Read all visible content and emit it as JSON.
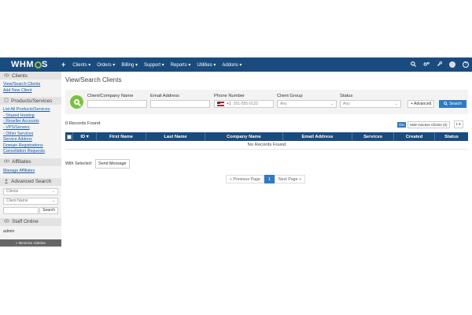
{
  "app": {
    "logo_text": "WHMCS"
  },
  "topnav": {
    "add_icon": "plus-icon",
    "items": [
      "Clients ▾",
      "Orders ▾",
      "Billing ▾",
      "Support ▾",
      "Reports ▾",
      "Utilities ▾",
      "Addons ▾"
    ],
    "right_icons": [
      "search-icon",
      "gears-icon",
      "wrench-icon",
      "user-icon",
      "help-icon"
    ]
  },
  "sidebar": {
    "clients": {
      "title": "Clients",
      "links": [
        "View/Search Clients",
        "Add New Client"
      ]
    },
    "products": {
      "title": "Products/Services",
      "links": [
        "List All Products/Services",
        "- Shared Hosting",
        "- Reseller Accounts",
        "- VPS/Servers",
        "- Other Services",
        "Service Addons",
        "Domain Registrations",
        "Cancellation Requests"
      ]
    },
    "affiliates": {
      "title": "Affiliates",
      "links": [
        "Manage Affiliates"
      ]
    },
    "advanced_search": {
      "title": "Advanced Search",
      "type_value": "Clients",
      "field_value": "Client Name",
      "search_button": "Search"
    },
    "staff_online": {
      "title": "Staff Online",
      "user": "admin"
    },
    "minimize": "« Minimise Sidebar"
  },
  "main": {
    "title": "View/Search Clients",
    "filters": {
      "name_label": "Client/Company Name",
      "email_label": "Email Address",
      "phone_label": "Phone Number",
      "phone_code": "+1",
      "phone_placeholder": "201-555-0123",
      "group_label": "Client Group",
      "group_value": "Any",
      "status_label": "Status",
      "status_value": "Any",
      "advanced_button": "+ Advanced",
      "search_button": "Search"
    },
    "records_text": "0 Records Found",
    "toggle": {
      "badge": "ON",
      "label": "Hide Inactive Clients (0)"
    },
    "per_page": "1 ▾",
    "table": {
      "columns": [
        "ID ▾",
        "First Name",
        "Last Name",
        "Company Name",
        "Email Address",
        "Services",
        "Created",
        "Status"
      ],
      "empty_text": "No Records Found"
    },
    "with_selected_label": "With Selected:",
    "send_message_button": "Send Message",
    "pager": {
      "prev": "« Previous Page",
      "current": "1",
      "next": "Next Page »"
    }
  }
}
